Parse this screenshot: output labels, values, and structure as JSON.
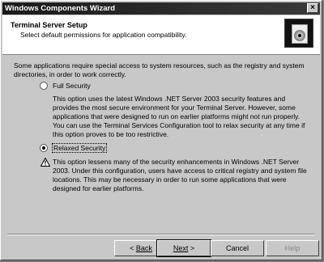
{
  "window": {
    "title": "Windows Components Wizard",
    "close_label": "×"
  },
  "header": {
    "title": "Terminal Server Setup",
    "subtitle": "Select default permissions for application compatibility."
  },
  "content": {
    "intro": "Some applications require special access to system resources, such as the registry and system directories, in order to work correctly.",
    "options": [
      {
        "label": "Full Security",
        "selected": false,
        "description": "This option uses the latest Windows .NET Server 2003 security features and provides the most secure environment for your Terminal Server. However, some applications that were designed to run on earlier platforms might not run properly. You can use the Terminal Services Configuration tool to relax security at any time if this option proves to be too restrictive."
      },
      {
        "label": "Relaxed Security",
        "selected": true,
        "description": "This option lessens many of the security enhancements in Windows .NET Server 2003. Under this configuration, users have access to critical registry and system file locations. This may be necessary in order to run some applications that were designed for earlier platforms."
      }
    ]
  },
  "buttons": {
    "back": "Back",
    "back_prefix": "< ",
    "next": "Next",
    "next_suffix": " >",
    "cancel": "Cancel",
    "help": "Help"
  },
  "icons": {
    "warning": "warning-icon",
    "setup": "setup-box-icon"
  }
}
